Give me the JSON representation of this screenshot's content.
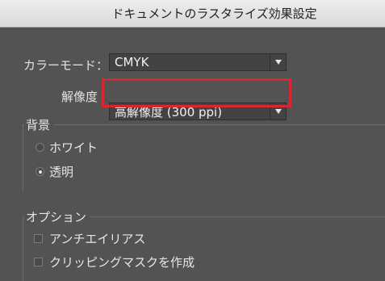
{
  "window": {
    "title": "ドキュメントのラスタライズ効果設定"
  },
  "color_mode": {
    "label": "カラーモード：",
    "value": "CMYK"
  },
  "resolution": {
    "label": "解像度",
    "value": "高解像度 (300 ppi)",
    "highlight_color": "#d9262f"
  },
  "background": {
    "title": "背景",
    "options": [
      {
        "label": "ホワイト",
        "selected": false
      },
      {
        "label": "透明",
        "selected": true
      }
    ]
  },
  "options": {
    "title": "オプション",
    "items": [
      {
        "label": "アンチエイリアス",
        "checked": false
      },
      {
        "label": "クリッピングマスクを作成",
        "checked": false
      }
    ]
  }
}
